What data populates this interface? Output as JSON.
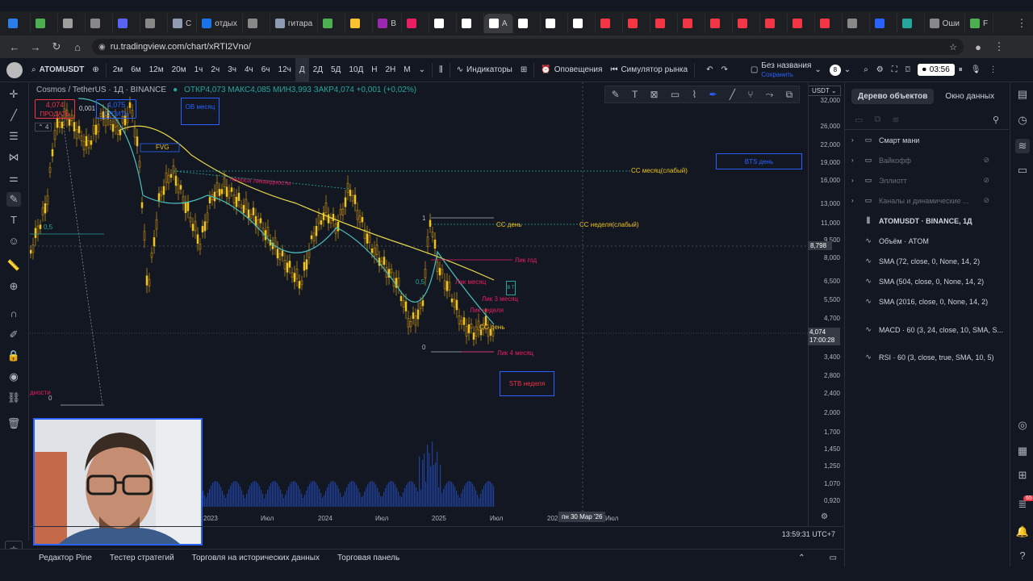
{
  "browser": {
    "tabs": [
      {
        "label": "",
        "color": "#2b7de9"
      },
      {
        "label": "",
        "color": "#4caf50"
      },
      {
        "label": "",
        "color": "#9e9e9e"
      },
      {
        "label": "",
        "color": "#888888"
      },
      {
        "label": "",
        "color": "#5865f2"
      },
      {
        "label": "",
        "color": "#888888"
      },
      {
        "label": "С",
        "color": "#8f9bb3"
      },
      {
        "label": "отдых",
        "color": "#1a73e8"
      },
      {
        "label": "",
        "color": "#888888"
      },
      {
        "label": "гитара",
        "color": "#8f9bb3"
      },
      {
        "label": "",
        "color": "#4caf50"
      },
      {
        "label": "",
        "color": "#fbc02d"
      },
      {
        "label": "В",
        "color": "#9c27b0"
      },
      {
        "label": "",
        "color": "#e91e63"
      },
      {
        "label": "",
        "color": "#ffffff"
      },
      {
        "label": "",
        "color": "#ffffff"
      },
      {
        "label": "A",
        "color": "#ffffff",
        "active": true
      },
      {
        "label": "",
        "color": "#ffffff"
      },
      {
        "label": "",
        "color": "#ffffff"
      },
      {
        "label": "",
        "color": "#ffffff"
      },
      {
        "label": "",
        "color": "#f23645"
      },
      {
        "label": "",
        "color": "#f23645"
      },
      {
        "label": "",
        "color": "#f23645"
      },
      {
        "label": "",
        "color": "#f23645"
      },
      {
        "label": "",
        "color": "#f23645"
      },
      {
        "label": "",
        "color": "#f23645"
      },
      {
        "label": "",
        "color": "#f23645"
      },
      {
        "label": "",
        "color": "#f23645"
      },
      {
        "label": "",
        "color": "#f23645"
      },
      {
        "label": "",
        "color": "#888888"
      },
      {
        "label": "",
        "color": "#2962ff"
      },
      {
        "label": "",
        "color": "#26a69a"
      },
      {
        "label": "Оши",
        "color": "#888888"
      },
      {
        "label": "F",
        "color": "#4caf50"
      }
    ],
    "url": "ru.tradingview.com/chart/xRTI2Vno/"
  },
  "toolbar": {
    "symbol": "ATOMUSDT",
    "intervals": [
      "2м",
      "6м",
      "12м",
      "20м",
      "1ч",
      "2ч",
      "3ч",
      "4ч",
      "6ч",
      "12ч",
      "Д",
      "2Д",
      "5Д",
      "10Д",
      "Н",
      "2Н",
      "М"
    ],
    "selected_interval": "Д",
    "indicators": "Индикаторы",
    "alerts": "Оповещения",
    "replay": "Симулятор рынка",
    "layout_name": "Без названия",
    "saved": "Сохранить",
    "layout_count": "8",
    "record_time": "03:56"
  },
  "chart": {
    "legend": {
      "title": "Cosmos / TetherUS · 1Д · BINANCE",
      "ohlc": "ОТКР4,073 МАКС4,085 МИН3,993 ЗАКР4,074 +0,001 (+0,02%)"
    },
    "sell": {
      "price": "4,074",
      "label": "ПРОДАТЬ"
    },
    "buy": {
      "price": "4,075",
      "label": "КУПИТЬ"
    },
    "spread": "0,001",
    "collapsed_count": "4",
    "currency": "USDT",
    "price_labels": [
      "32,000",
      "26,000",
      "22,000",
      "19,000",
      "16,000",
      "13,000",
      "11,000",
      "9,500",
      "8,000",
      "6,500",
      "5,500",
      "4,700",
      "3,400",
      "2,800",
      "2,400",
      "2,000",
      "1,700",
      "1,450",
      "1,250",
      "1,070",
      "0,920"
    ],
    "hover_price": "8,798",
    "current_price": "4,074",
    "countdown": "17:00:28",
    "time_labels": [
      "2023",
      "Июл",
      "2024",
      "Июл",
      "2025",
      "Июл",
      "202",
      "Июл"
    ],
    "crosshair_date": "пн 30 Мар '26",
    "timezone": "13:59:31 UTC+7",
    "annotations": {
      "ob_month": "ОВ месяц",
      "fvg": "FVG",
      "bts_day": "BTS день",
      "stb_week": "STB неделя",
      "cc_month_weak": "СС месяц(слабый)",
      "cc_day": "СС день",
      "cc_week_weak": "СС неделя(слабый)",
      "liq_year": "Лик год",
      "liq_month": "Лик месяц",
      "liq_3month": "Лик 3 месяц",
      "liq_week": "Лик неделя",
      "cc_day2": "СС день",
      "liq_4month": "Лик 4 месяц",
      "liquidity": "полоса ликвидности",
      "liquidity_left": "дности",
      "fib_05": "0,5",
      "fib_05b": "0,5",
      "fib_0": "0",
      "fib_0b": "0",
      "fib_1": "1",
      "bt": "B T"
    }
  },
  "bottom": {
    "items": [
      "Редактор Pine",
      "Тестер стратегий",
      "Торговля на исторических данных",
      "Торговая панель"
    ]
  },
  "object_tree": {
    "tabs": [
      "Дерево объектов",
      "Окно данных"
    ],
    "rows": [
      {
        "label": "Смарт мани",
        "type": "folder",
        "dim": false
      },
      {
        "label": "Вайкофф",
        "type": "folder",
        "dim": true
      },
      {
        "label": "Эллиотт",
        "type": "folder",
        "dim": true
      },
      {
        "label": "Каналы и динамические ...",
        "type": "folder",
        "dim": true
      },
      {
        "label": "ATOMUSDT · BINANCE, 1Д",
        "type": "series",
        "dim": false
      },
      {
        "label": "Объём · ATOM",
        "type": "study",
        "dim": false
      },
      {
        "label": "SMA (72, close, 0, None, 14, 2)",
        "type": "study",
        "dim": false
      },
      {
        "label": "SMA (504, close, 0, None, 14, 2)",
        "type": "study",
        "dim": false
      },
      {
        "label": "SMA (2016, close, 0, None, 14, 2)",
        "type": "study",
        "dim": false
      },
      {
        "label": "MACD · 60 (3, 24, close, 10, SMA, S...",
        "type": "study",
        "dim": false
      },
      {
        "label": "RSI · 60 (3, close, true, SMA, 10, 5)",
        "type": "study",
        "dim": false
      }
    ]
  },
  "notifications_badge": "65"
}
